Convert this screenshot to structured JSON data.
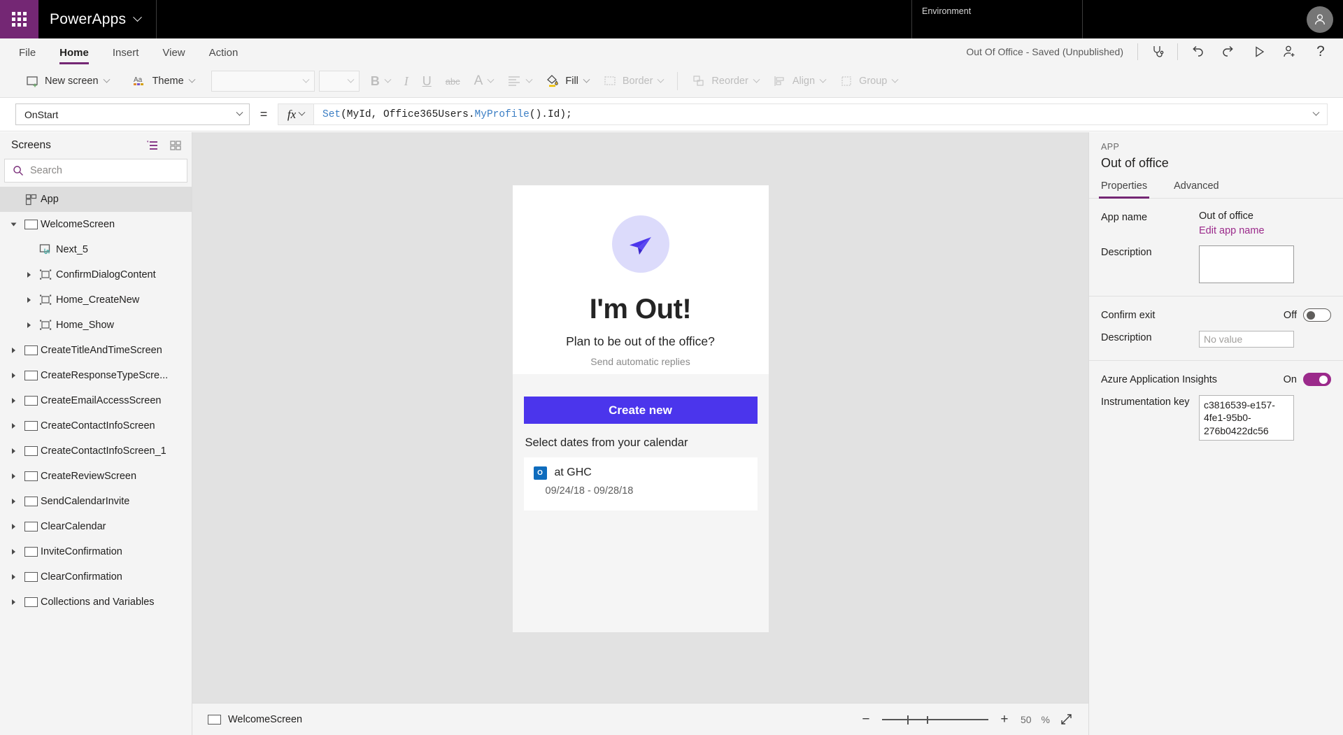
{
  "topbar": {
    "waffle_icon": "waffle-grid-icon",
    "brand": "PowerApps",
    "brand_chevron_icon": "chevron-down-icon",
    "environment_label": "Environment",
    "environment_value": "",
    "account_icon": "person-icon"
  },
  "menubar": {
    "items": [
      {
        "label": "File",
        "active": false
      },
      {
        "label": "Home",
        "active": true
      },
      {
        "label": "Insert",
        "active": false
      },
      {
        "label": "View",
        "active": false
      },
      {
        "label": "Action",
        "active": false
      }
    ],
    "app_status": "Out Of Office  - Saved (Unpublished)",
    "icons": [
      {
        "name": "stethoscope-icon",
        "glyph": "⚕"
      },
      {
        "name": "undo-icon",
        "glyph": "↶"
      },
      {
        "name": "redo-icon",
        "glyph": "↷"
      },
      {
        "name": "play-preview-icon",
        "glyph": "▷"
      },
      {
        "name": "share-person-icon",
        "glyph": "☺"
      },
      {
        "name": "help-icon",
        "glyph": "?"
      }
    ]
  },
  "ribbon": {
    "new_screen": "New screen",
    "theme": "Theme",
    "font_family_value": "",
    "font_size_value": "",
    "bold": "B",
    "italic": "I",
    "underline": "U",
    "strikethrough": "abc",
    "font_color": "A",
    "align": "align-icon",
    "fill": "Fill",
    "border": "Border",
    "reorder": "Reorder",
    "align_group": "Align",
    "group": "Group"
  },
  "formula": {
    "property_selected": "OnStart",
    "equals": "=",
    "fx": "fx",
    "text_parts": [
      {
        "t": "Set",
        "c": "fn"
      },
      {
        "t": "(MyId, Office365Users.",
        "c": "plain"
      },
      {
        "t": "MyProfile",
        "c": "fn"
      },
      {
        "t": "().Id);",
        "c": "plain"
      }
    ],
    "full_text": "Set(MyId, Office365Users.MyProfile().Id);"
  },
  "left_panel": {
    "title": "Screens",
    "tree_view_icon": "tree-view-icon",
    "thumbnail_view_icon": "thumbnail-view-icon",
    "search_placeholder": "Search",
    "search_value": "",
    "search_icon": "search-icon",
    "tree": [
      {
        "label": "App",
        "indent": 0,
        "icon": "app-icon",
        "arrow": "none",
        "selected": true
      },
      {
        "label": "WelcomeScreen",
        "indent": 0,
        "icon": "screen-icon",
        "arrow": "open",
        "selected": false
      },
      {
        "label": "Next_5",
        "indent": 1,
        "icon": "button-icon",
        "arrow": "none",
        "selected": false
      },
      {
        "label": "ConfirmDialogContent",
        "indent": 1,
        "icon": "group-icon",
        "arrow": "closed",
        "selected": false
      },
      {
        "label": "Home_CreateNew",
        "indent": 1,
        "icon": "group-icon",
        "arrow": "closed",
        "selected": false
      },
      {
        "label": "Home_Show",
        "indent": 1,
        "icon": "group-icon",
        "arrow": "closed",
        "selected": false
      },
      {
        "label": "CreateTitleAndTimeScreen",
        "indent": 0,
        "icon": "screen-icon",
        "arrow": "closed",
        "selected": false
      },
      {
        "label": "CreateResponseTypeScre...",
        "indent": 0,
        "icon": "screen-icon",
        "arrow": "closed",
        "selected": false
      },
      {
        "label": "CreateEmailAccessScreen",
        "indent": 0,
        "icon": "screen-icon",
        "arrow": "closed",
        "selected": false
      },
      {
        "label": "CreateContactInfoScreen",
        "indent": 0,
        "icon": "screen-icon",
        "arrow": "closed",
        "selected": false
      },
      {
        "label": "CreateContactInfoScreen_1",
        "indent": 0,
        "icon": "screen-icon",
        "arrow": "closed",
        "selected": false
      },
      {
        "label": "CreateReviewScreen",
        "indent": 0,
        "icon": "screen-icon",
        "arrow": "closed",
        "selected": false
      },
      {
        "label": "SendCalendarInvite",
        "indent": 0,
        "icon": "screen-icon",
        "arrow": "closed",
        "selected": false
      },
      {
        "label": "ClearCalendar",
        "indent": 0,
        "icon": "screen-icon",
        "arrow": "closed",
        "selected": false
      },
      {
        "label": "InviteConfirmation",
        "indent": 0,
        "icon": "screen-icon",
        "arrow": "closed",
        "selected": false
      },
      {
        "label": "ClearConfirmation",
        "indent": 0,
        "icon": "screen-icon",
        "arrow": "closed",
        "selected": false
      },
      {
        "label": "Collections and Variables",
        "indent": 0,
        "icon": "screen-icon",
        "arrow": "closed",
        "selected": false
      }
    ]
  },
  "canvas": {
    "app": {
      "logo_icon": "paper-plane-icon",
      "title": "I'm Out!",
      "subtitle": "Plan to be out of the office?",
      "caption": "Send automatic replies",
      "create_button": "Create new",
      "section_label": "Select dates from your calendar",
      "event": {
        "source_icon": "outlook-icon",
        "title": "at GHC",
        "dates": "09/24/18 - 09/28/18"
      }
    }
  },
  "bottom_bar": {
    "screen_name": "WelcomeScreen",
    "screen_icon": "screen-icon",
    "zoom_out_icon": "minus-icon",
    "zoom_in_icon": "plus-icon",
    "zoom_value": "50",
    "zoom_unit": "%",
    "fit_icon": "fit-screen-icon"
  },
  "right_panel": {
    "kicker": "APP",
    "title": "Out of office",
    "tabs": [
      {
        "label": "Properties",
        "active": true
      },
      {
        "label": "Advanced",
        "active": false
      }
    ],
    "app_name_label": "App name",
    "app_name_value": "Out of office",
    "edit_app_name_link": "Edit app name",
    "description_label": "Description",
    "description_value": "",
    "confirm_exit_label": "Confirm exit",
    "confirm_exit_state": "Off",
    "confirm_exit_on": false,
    "confirm_description_label": "Description",
    "confirm_description_placeholder": "No value",
    "insights_label": "Azure Application Insights",
    "insights_state": "On",
    "insights_on": true,
    "instrumentation_label": "Instrumentation key",
    "instrumentation_value": "c3816539-e157-4fe1-95b0-276b0422dc56"
  },
  "colors": {
    "brand_purple": "#742774",
    "accent_magenta": "#9b2a8b",
    "app_blue": "#4b35ec",
    "black_bar": "#000000",
    "chrome_gray": "#f4f4f4",
    "canvas_gray": "#e2e2e2"
  }
}
